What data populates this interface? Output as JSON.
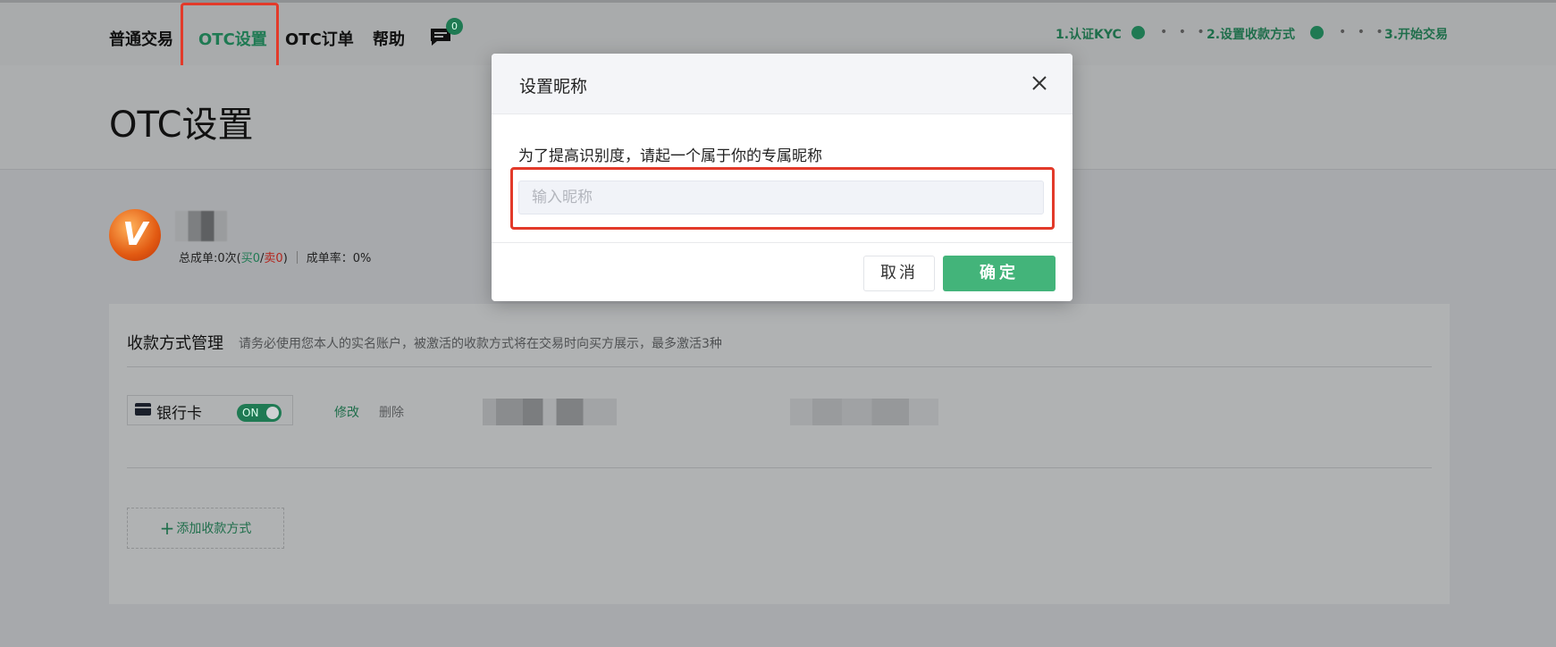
{
  "nav": {
    "items": [
      "普通交易",
      "OTC设置",
      "OTC订单",
      "帮助"
    ],
    "active_index": 1,
    "message_count": "0"
  },
  "steps": {
    "step1": "1.认证KYC",
    "step2": "2.设置收款方式",
    "step3": "3.开始交易",
    "separator": "• • •"
  },
  "page": {
    "title": "OTC设置",
    "avatar_letter": "V",
    "stats_prefix": "总成单:0次(",
    "stats_buy": "买0",
    "stats_slash": "/",
    "stats_sell": "卖0",
    "stats_suffix": ")",
    "rate": "成单率：0%"
  },
  "payment": {
    "title": "收款方式管理",
    "hint": "请务必使用您本人的实名账户，被激活的收款方式将在交易时向买方展示，最多激活3种",
    "method_label": "银行卡",
    "toggle_label": "ON",
    "edit_label": "修改",
    "delete_label": "删除",
    "add_label": "添加收款方式"
  },
  "modal": {
    "title": "设置昵称",
    "description": "为了提高识别度，请起一个属于你的专属昵称",
    "input_placeholder": "输入昵称",
    "input_value": "",
    "cancel_label": "取消",
    "confirm_label": "确定"
  },
  "colors": {
    "accent": "#43b47a",
    "highlight": "#e23a2a"
  },
  "icons": {
    "message": "chat-bubble-icon",
    "close": "close-icon",
    "card": "bank-card-icon",
    "add": "plus-icon"
  }
}
